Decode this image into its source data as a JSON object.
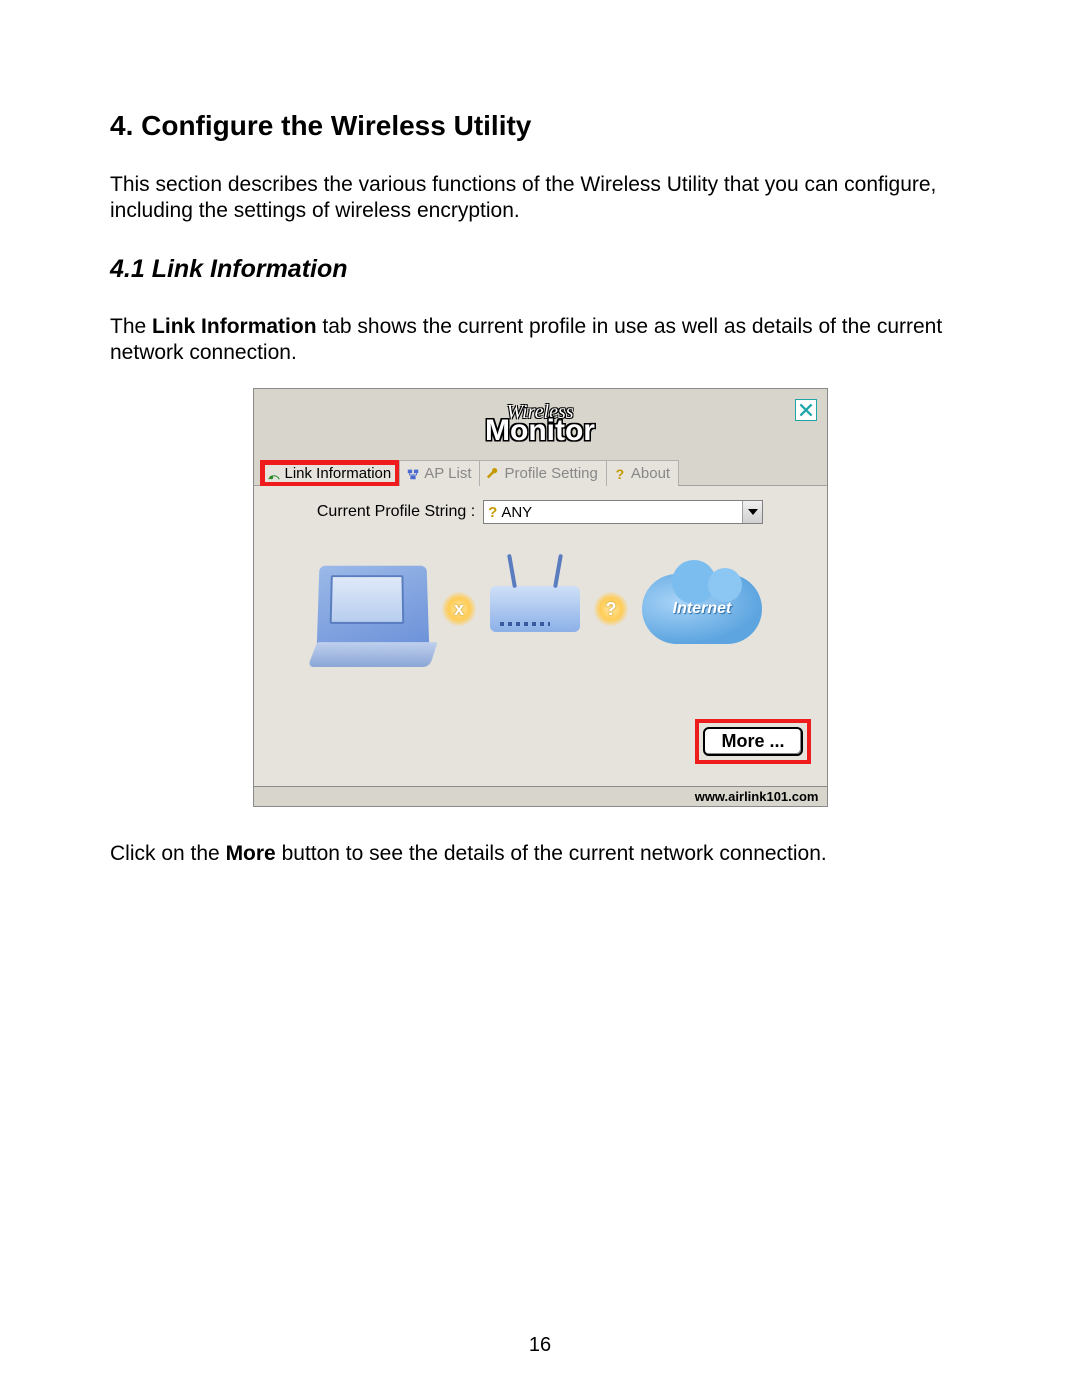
{
  "page": {
    "h1": "4. Configure the Wireless Utility",
    "intro": "This section describes the various functions of the Wireless Utility that you can configure, including the settings of wireless encryption.",
    "h2": "4.1 Link Information",
    "para2_pre": "The ",
    "para2_bold": "Link Information",
    "para2_post": " tab shows the current profile in use as well as details of the current network connection.",
    "para3_pre": "Click on the ",
    "para3_bold": "More",
    "para3_post": " button to see the details of the current network connection.",
    "number": "16"
  },
  "app": {
    "logo_line1": "Wireless",
    "logo_line2": "Monitor",
    "tabs": {
      "link": "Link Information",
      "ap": "AP List",
      "profile": "Profile Setting",
      "about": "About"
    },
    "profile_label": "Current Profile String :",
    "profile_value": "ANY",
    "cloud_label": "Internet",
    "status_left": "x",
    "status_right": "?",
    "more_button": "More ...",
    "footer_url": "www.airlink101.com"
  }
}
